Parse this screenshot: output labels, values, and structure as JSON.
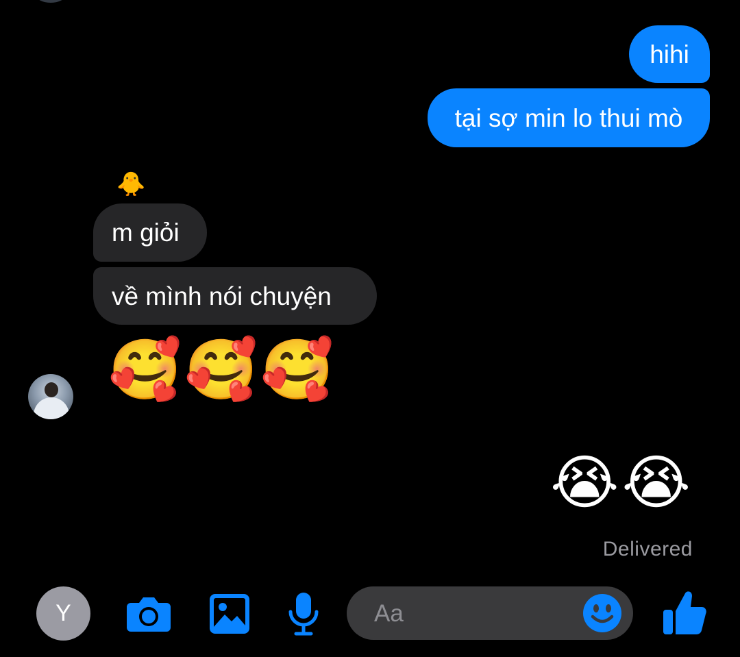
{
  "conversation": {
    "outgoing": [
      {
        "text": "hihi"
      },
      {
        "text": "tại sợ min lo thui mò"
      }
    ],
    "incoming_reaction": "🐥",
    "incoming": [
      {
        "text": "m giỏi"
      },
      {
        "text": "về mình nói chuyện"
      }
    ],
    "incoming_emoji": "🥰🥰🥰",
    "outgoing_emoji": "😭😭",
    "status": "Delivered"
  },
  "composer": {
    "user_initial": "Y",
    "placeholder": "Aa",
    "icons": [
      "camera-icon",
      "image-icon",
      "microphone-icon",
      "smiley-icon",
      "thumbs-up-icon"
    ]
  },
  "colors": {
    "background": "#000000",
    "outgoing_bubble": "#0a84ff",
    "incoming_bubble": "#262628",
    "accent": "#0a84ff",
    "input_bg": "#3a3a3c",
    "status_text": "#9b9ba1"
  }
}
